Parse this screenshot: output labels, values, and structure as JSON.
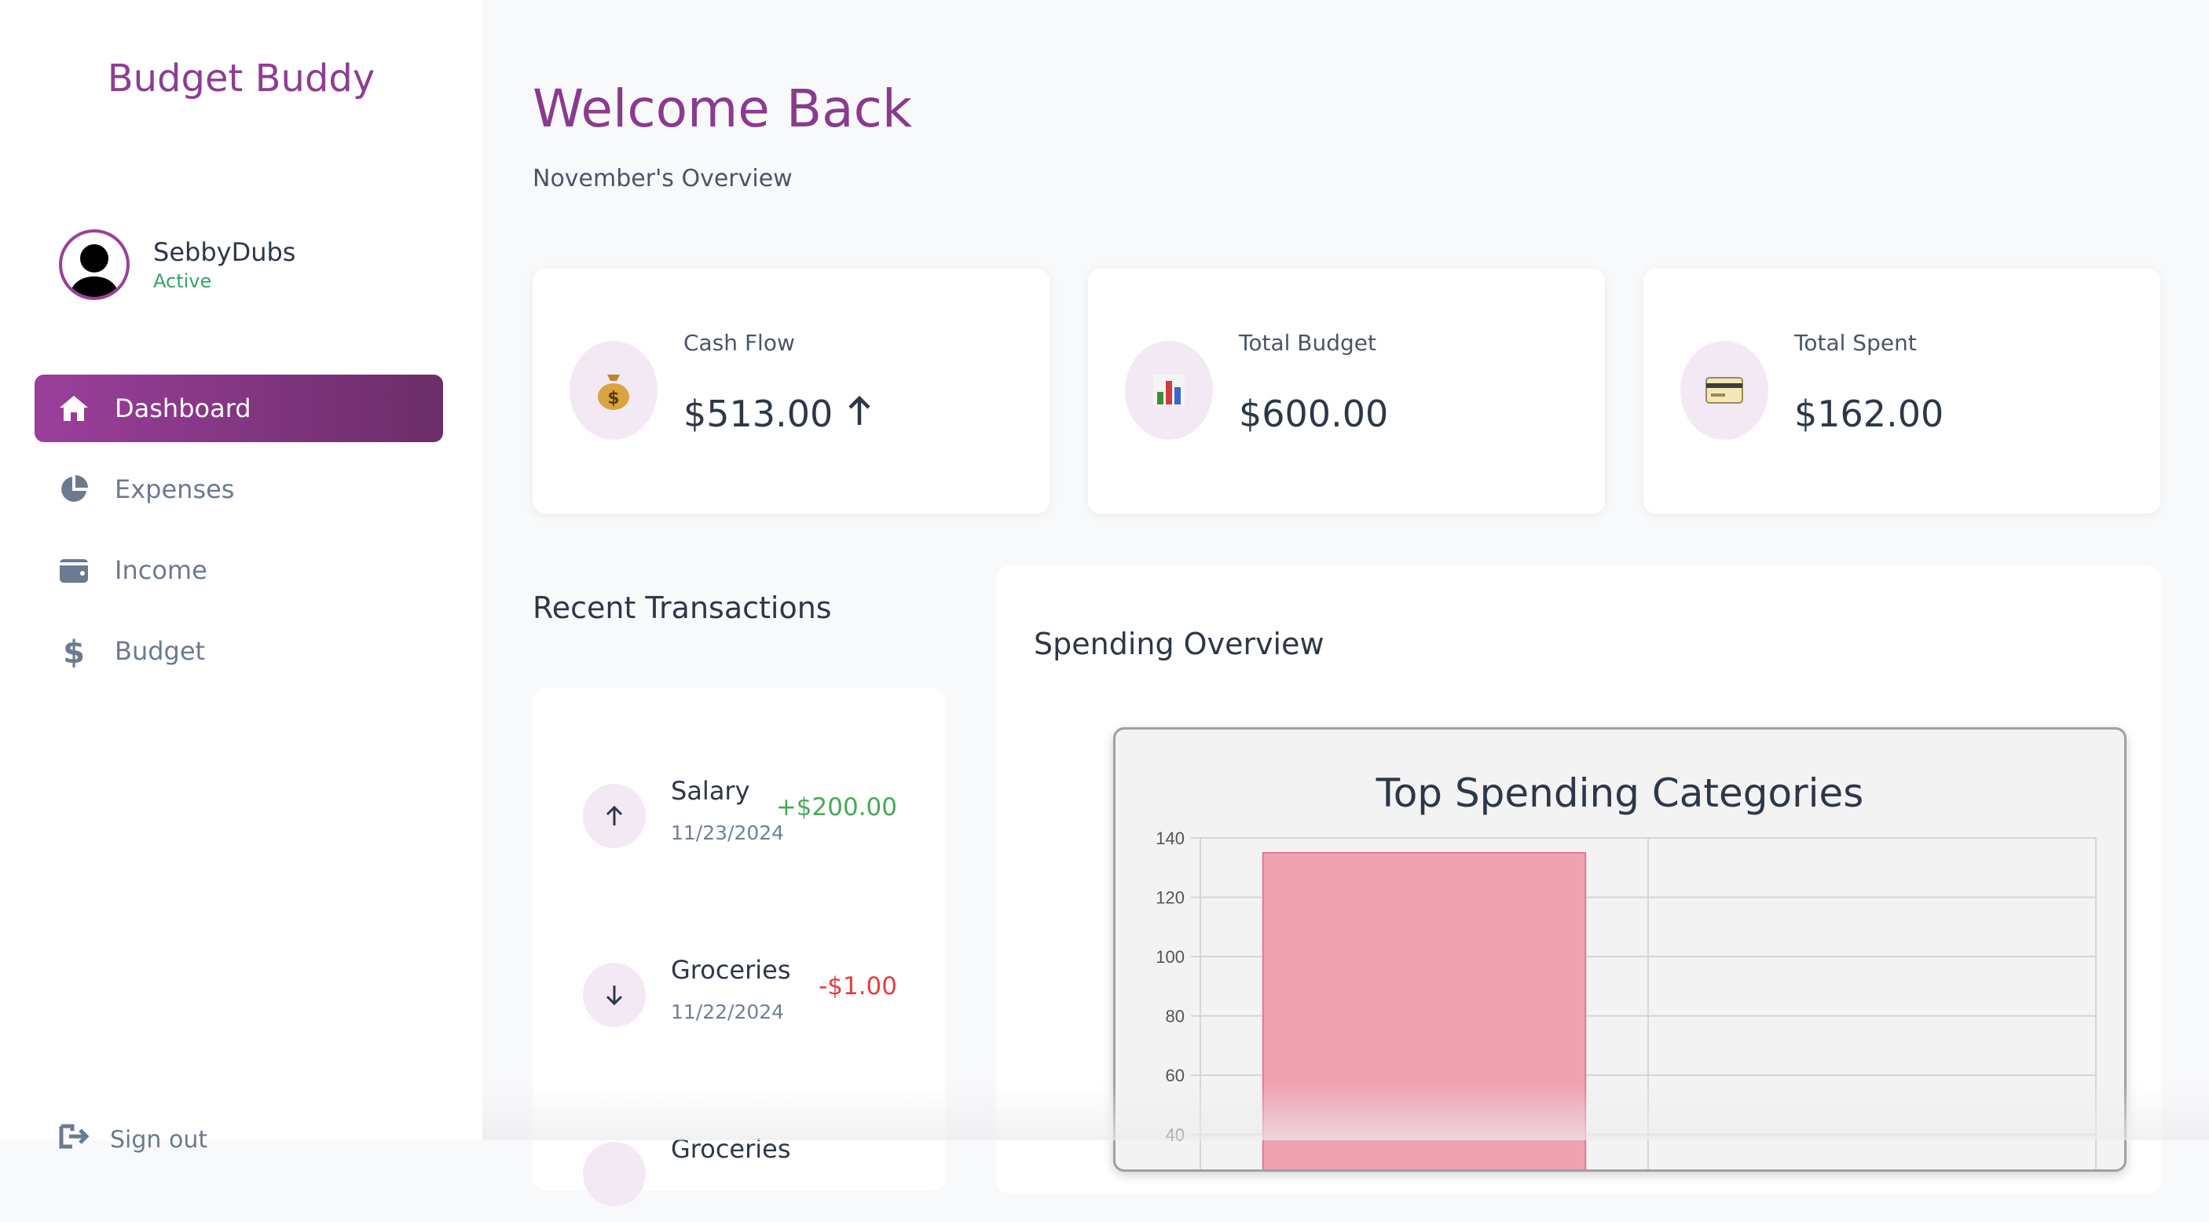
{
  "sidebar": {
    "brand": "Budget Buddy",
    "user": {
      "name": "SebbyDubs",
      "status": "Active"
    },
    "nav": [
      {
        "label": "Dashboard",
        "icon": "home-icon",
        "active": true
      },
      {
        "label": "Expenses",
        "icon": "pie-chart-icon",
        "active": false
      },
      {
        "label": "Income",
        "icon": "wallet-icon",
        "active": false
      },
      {
        "label": "Budget",
        "icon": "dollar-icon",
        "active": false
      }
    ],
    "signout": "Sign out"
  },
  "header": {
    "title": "Welcome Back",
    "subtitle": "November's Overview"
  },
  "cards": [
    {
      "label": "Cash Flow",
      "value": "$513.00",
      "icon": "money-bag-icon",
      "trend": "up"
    },
    {
      "label": "Total Budget",
      "value": "$600.00",
      "icon": "bar-chart-icon"
    },
    {
      "label": "Total Spent",
      "value": "$162.00",
      "icon": "credit-card-icon"
    }
  ],
  "transactions": {
    "title": "Recent Transactions",
    "items": [
      {
        "name": "Salary",
        "date": "11/23/2024",
        "amount": "+$200.00",
        "direction": "up"
      },
      {
        "name": "Groceries",
        "date": "11/22/2024",
        "amount": "-$1.00",
        "direction": "down"
      },
      {
        "name": "Groceries",
        "date": "",
        "amount": "",
        "direction": "down"
      }
    ]
  },
  "spending": {
    "title": "Spending Overview",
    "chart_data": {
      "type": "bar",
      "title": "Top Spending Categories",
      "categories": [
        "",
        ""
      ],
      "values": [
        135,
        null
      ],
      "ylim": [
        40,
        140
      ],
      "yticks": [
        40,
        60,
        80,
        100,
        120,
        140
      ],
      "grid": true,
      "bar_color": "#f0a2b2",
      "bar_border": "#e5788f"
    }
  },
  "colors": {
    "accent": "#8e3d92",
    "positive": "#48a85a",
    "negative": "#e53e3e"
  }
}
